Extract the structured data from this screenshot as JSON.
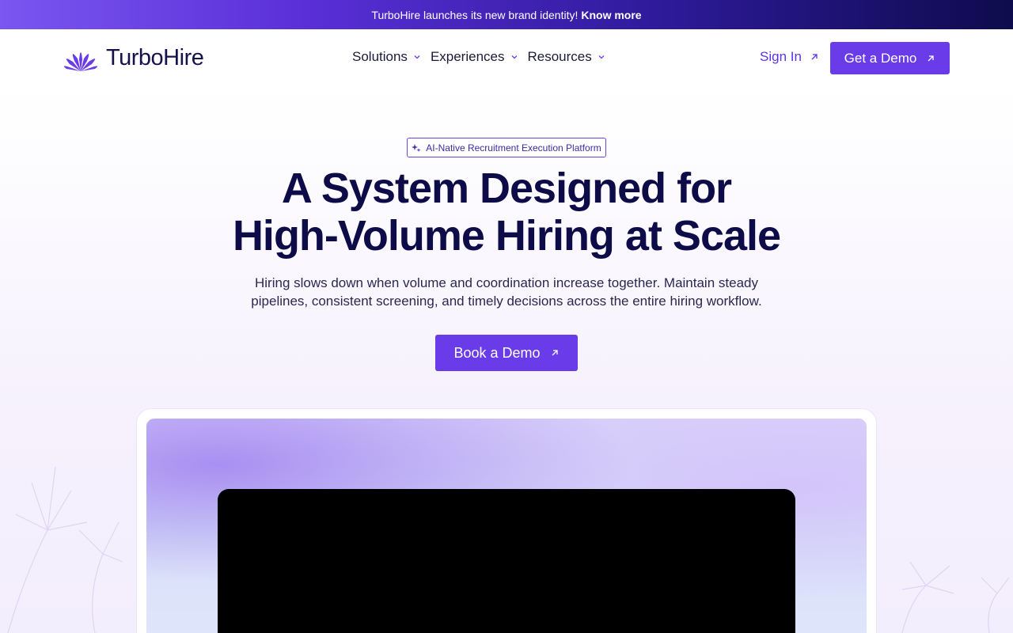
{
  "announcement": {
    "text": "TurboHire launches its new brand identity!",
    "link": "Know more"
  },
  "nav": {
    "logo": "TurboHire",
    "menu": [
      {
        "label": "Solutions"
      },
      {
        "label": "Experiences"
      },
      {
        "label": "Resources"
      }
    ],
    "signin": "Sign In",
    "cta": "Get a Demo"
  },
  "hero": {
    "badge": "AI-Native Recruitment Execution Platform",
    "title_line1": "A System Designed for",
    "title_line2": "High-Volume Hiring at Scale",
    "subtitle_line1": "Hiring slows down when volume and coordination increase together. Maintain steady",
    "subtitle_line2": "pipelines, consistent screening, and timely decisions across the entire hiring workflow.",
    "cta": "Book a Demo"
  },
  "colors": {
    "accent": "#6a3be8",
    "heading": "#0d0b48"
  },
  "icons": {
    "logo": "burst-logo-icon",
    "chevron": "chevron-down-icon",
    "arrow": "arrow-up-right-icon",
    "sparkle": "sparkle-icon"
  }
}
